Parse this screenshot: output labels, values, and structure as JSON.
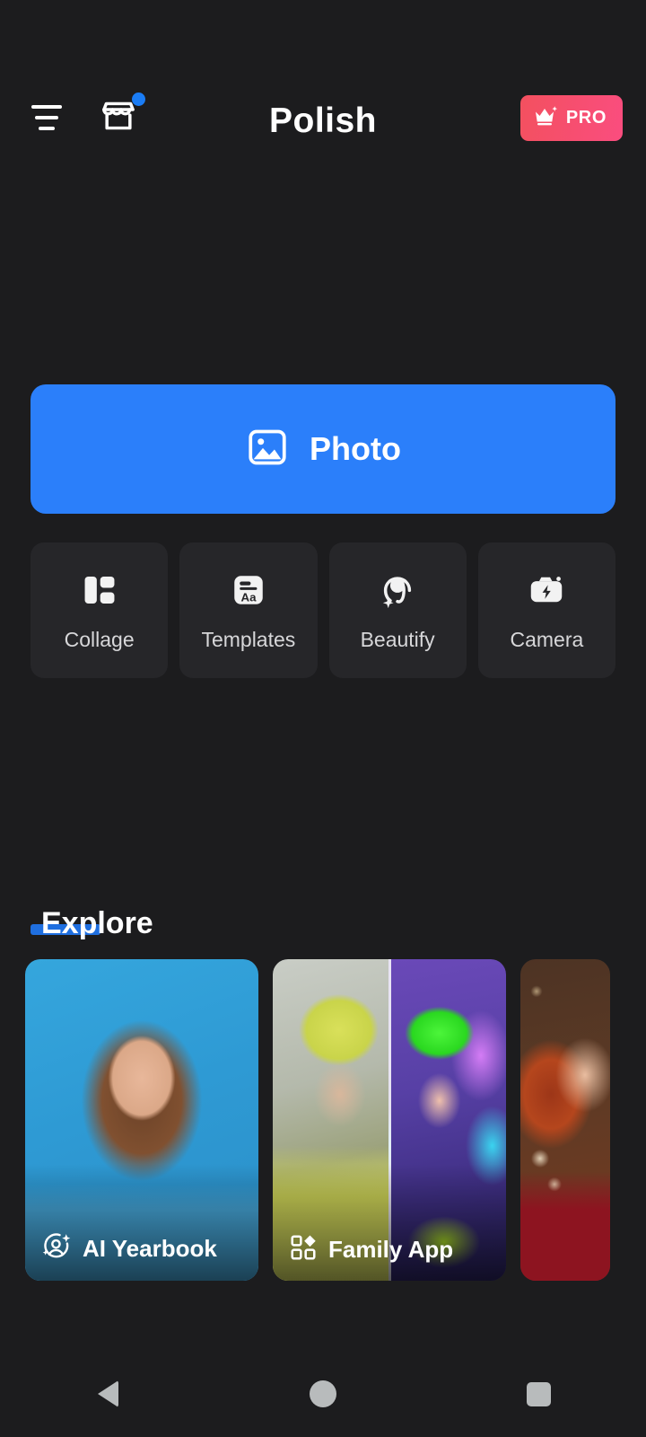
{
  "app": {
    "brand": "Polish",
    "background_color": "#1c1c1e",
    "accent_color": "#2b7ffa"
  },
  "header": {
    "menu_icon": "hamburger-menu-icon",
    "store_icon": "storefront-icon",
    "store_has_notification": true,
    "notification_dot_color": "#1a7cf5",
    "pro": {
      "label": "PRO",
      "icon": "crown-icon",
      "gradient_from": "#f3505f",
      "gradient_to": "#fa4d7f"
    }
  },
  "primary_action": {
    "label": "Photo",
    "icon": "image-icon",
    "color": "#2b7ffa"
  },
  "quick_tiles": [
    {
      "label": "Collage",
      "icon": "collage-layout-icon"
    },
    {
      "label": "Templates",
      "icon": "template-text-icon"
    },
    {
      "label": "Beautify",
      "icon": "face-sparkle-icon"
    },
    {
      "label": "Camera",
      "icon": "camera-flash-icon"
    }
  ],
  "explore": {
    "title": "Explore",
    "accent_color": "#1f6fe0",
    "cards": [
      {
        "label": "AI Yearbook",
        "icon": "person-sparkle-icon",
        "photo": "yearbook-portrait-blue-background"
      },
      {
        "label": "Family App",
        "icon": "grid-diamond-icon",
        "photo": "before-after-neon-portrait-split"
      },
      {
        "label": "",
        "icon": "",
        "photo": "smiling-redhead-holiday-bokeh"
      }
    ]
  },
  "navbar": {
    "back_label": "Back",
    "home_label": "Home",
    "recents_label": "Recents",
    "icon_color": "#b8bbbc"
  }
}
